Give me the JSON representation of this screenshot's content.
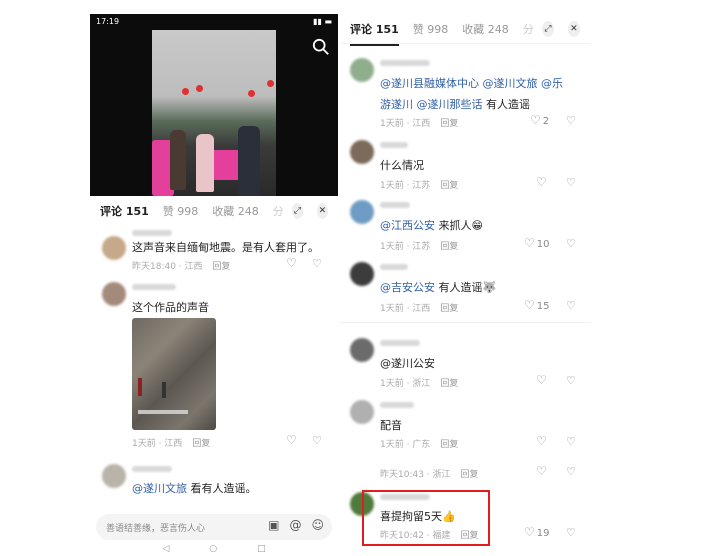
{
  "status": {
    "time": "17:19"
  },
  "tabs": {
    "comments": "评论 151",
    "likes": "赞 998",
    "favorites": "收藏 248",
    "more": "分"
  },
  "left_comments": [
    {
      "text": "这声音来自缅甸地震。是有人套用了。",
      "meta": "昨天18:40 · 江西",
      "reply": "回复"
    },
    {
      "text": "这个作品的声音",
      "meta": "1天前 · 江西",
      "reply": "回复"
    },
    {
      "mention": "@遂川文旅",
      "text": " 看有人造谣。"
    }
  ],
  "input": {
    "placeholder": "善语结善缘，恶言伤人心"
  },
  "right_comments": [
    {
      "line1": "@遂川县融媒体中心 @遂川文旅 @乐",
      "line2_mention": "游遂川 @遂川那些话",
      "line2_text": " 有人造谣",
      "meta": "1天前 · 江西",
      "reply": "回复",
      "likes": "2"
    },
    {
      "text": "什么情况",
      "meta": "1天前 · 江苏",
      "reply": "回复"
    },
    {
      "mention": "@江西公安",
      "text": " 来抓人😁",
      "meta": "1天前 · 江苏",
      "reply": "回复",
      "likes": "10"
    },
    {
      "mention": "@吉安公安",
      "text": " 有人造谣🐺",
      "meta": "1天前 · 江西",
      "reply": "回复",
      "likes": "15"
    },
    {
      "text": "@遂川公安",
      "meta": "1天前 · 浙江",
      "reply": "回复"
    },
    {
      "text": "配音",
      "meta": "1天前 · 广东",
      "reply": "回复"
    },
    {
      "meta": "昨天10:43 · 浙江",
      "reply": "回复"
    },
    {
      "text": "喜提拘留5天👍",
      "meta": "昨天10:42 · 福建",
      "reply": "回复",
      "likes": "19"
    }
  ],
  "icons": {
    "heart": "heart-icon",
    "thumb": "dislike-icon",
    "close": "close-icon",
    "search": "search-icon"
  }
}
